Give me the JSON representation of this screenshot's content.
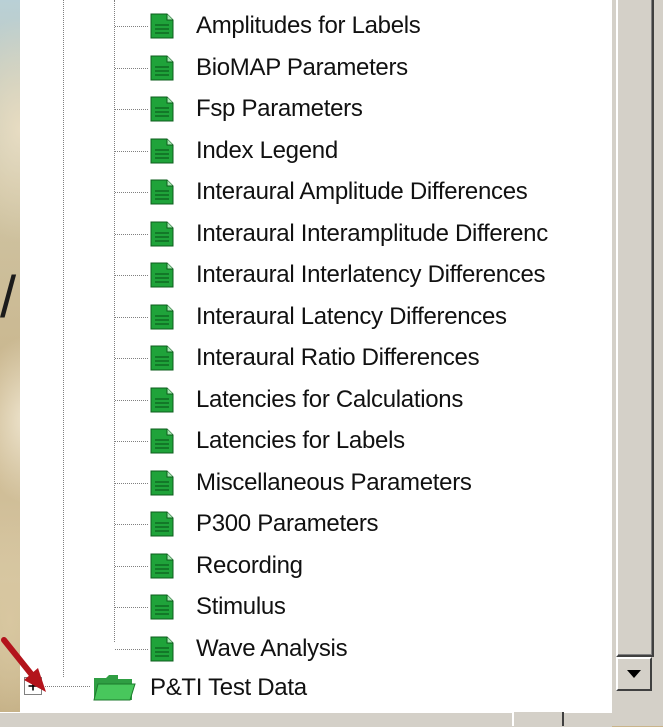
{
  "tree": {
    "items": [
      {
        "label": "Amplitudes for Labels"
      },
      {
        "label": "BioMAP Parameters"
      },
      {
        "label": "Fsp Parameters"
      },
      {
        "label": "Index Legend"
      },
      {
        "label": "Interaural Amplitude Differences"
      },
      {
        "label": "Interaural Interamplitude Differenc"
      },
      {
        "label": "Interaural Interlatency Differences"
      },
      {
        "label": "Interaural Latency Differences"
      },
      {
        "label": "Interaural Ratio Differences"
      },
      {
        "label": "Latencies for Calculations"
      },
      {
        "label": "Latencies for Labels"
      },
      {
        "label": "Miscellaneous Parameters"
      },
      {
        "label": "P300 Parameters"
      },
      {
        "label": "Recording"
      },
      {
        "label": "Stimulus"
      },
      {
        "label": "Wave Analysis"
      }
    ],
    "folder": {
      "label": "P&TI Test Data",
      "expander": "+"
    }
  },
  "background": {
    "slash_glyph": "/"
  },
  "colors": {
    "doc_icon_green": "#1fa33a",
    "folder_green": "#33b54a",
    "arrow_red": "#b3141c"
  },
  "icons": {
    "document": "document-icon",
    "folder": "folder-icon",
    "expand": "plus-icon",
    "scroll_down": "chevron-down-icon"
  }
}
